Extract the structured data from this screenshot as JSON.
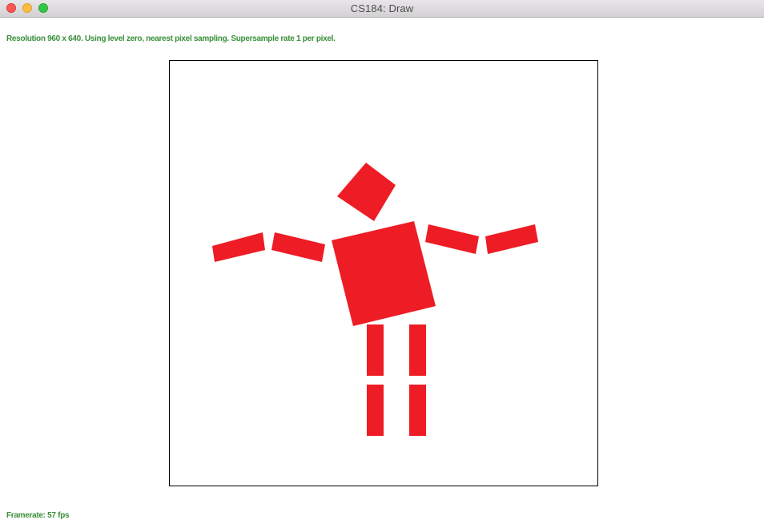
{
  "window": {
    "title": "CS184: Draw",
    "controls": {
      "close_icon": "close-icon",
      "minimize_icon": "minimize-icon",
      "zoom_icon": "zoom-icon"
    }
  },
  "hud": {
    "status": "Resolution 960 x 640. Using level zero, nearest pixel sampling. Supersample rate 1 per pixel.",
    "framerate": "Framerate: 57 fps"
  },
  "colors": {
    "shape_fill": "#ee1c24",
    "hud_text": "#3a8f3a",
    "canvas_border": "#000000"
  }
}
